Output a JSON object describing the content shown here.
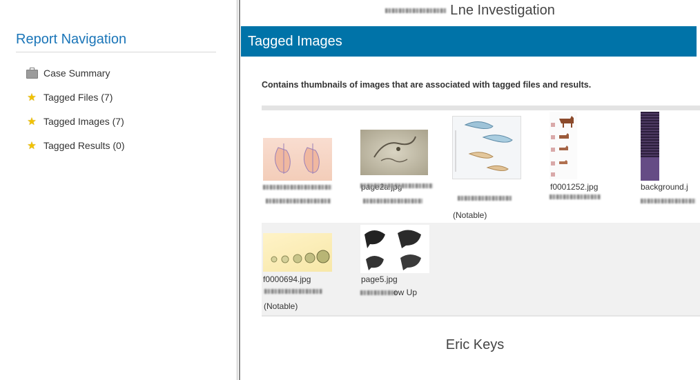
{
  "nav": {
    "title": "Report Navigation",
    "items": [
      {
        "label": "Case Summary",
        "icon": "briefcase-icon"
      },
      {
        "label": "Tagged Files (7)",
        "icon": "star-icon"
      },
      {
        "label": "Tagged Images (7)",
        "icon": "star-icon"
      },
      {
        "label": "Tagged Results (0)",
        "icon": "star-icon"
      }
    ]
  },
  "main": {
    "case_title": "ne Investigation",
    "section_header": "Tagged Images",
    "description": "Contains thumbnails of images that are associated with tagged files and results.",
    "thumbnails": [
      {
        "filename": "",
        "note": ""
      },
      {
        "filename": "page2a.jpg",
        "note": "(Notable)"
      },
      {
        "filename": "",
        "note": ""
      },
      {
        "filename": "f0001252.jpg",
        "note": ""
      },
      {
        "filename": "background.j",
        "note": ""
      },
      {
        "filename": "f0000694.jpg",
        "note": "(Notable)"
      },
      {
        "filename": "page5.jpg",
        "note": "ow Up"
      }
    ],
    "footer_name": "Eric Keys"
  },
  "colors": {
    "header_blue": "#0073a8",
    "nav_title_blue": "#1a75b8",
    "star_yellow": "#f2c200"
  }
}
